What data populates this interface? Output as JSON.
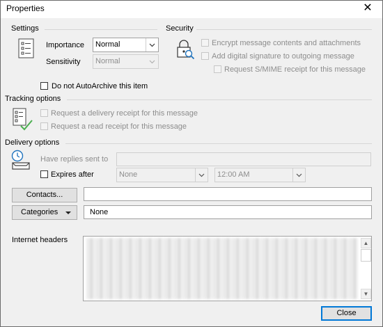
{
  "window": {
    "title": "Properties"
  },
  "settings": {
    "header": "Settings",
    "importance_label": "Importance",
    "importance_value": "Normal",
    "sensitivity_label": "Sensitivity",
    "sensitivity_value": "Normal",
    "autoarchive_label": "Do not AutoArchive this item"
  },
  "security": {
    "header": "Security",
    "encrypt_label": "Encrypt message contents and attachments",
    "signature_label": "Add digital signature to outgoing message",
    "smime_label": "Request S/MIME receipt for this message"
  },
  "tracking": {
    "header": "Tracking options",
    "delivery_receipt_label": "Request a delivery receipt for this message",
    "read_receipt_label": "Request a read receipt for this message"
  },
  "delivery": {
    "header": "Delivery options",
    "replies_label": "Have replies sent to",
    "replies_value": "",
    "expires_label": "Expires after",
    "expires_date": "None",
    "expires_time": "12:00 AM"
  },
  "contacts": {
    "button_label": "Contacts...",
    "value": ""
  },
  "categories": {
    "button_label": "Categories",
    "value": "None"
  },
  "internet_headers": {
    "label": "Internet headers"
  },
  "footer": {
    "close_label": "Close"
  }
}
